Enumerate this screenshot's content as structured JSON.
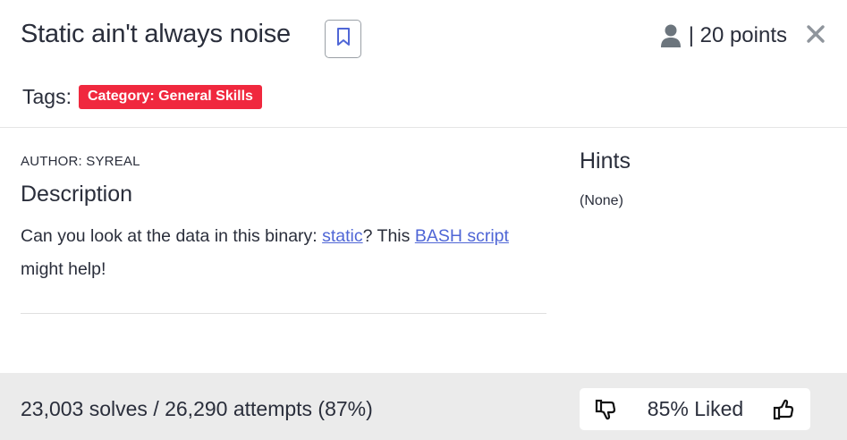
{
  "challenge": {
    "title": "Static ain't always noise",
    "points_label": "| 20 points"
  },
  "tags": {
    "label": "Tags:",
    "badges": [
      "Category: General Skills"
    ],
    "badge_color": "#f0283e"
  },
  "details": {
    "author": "AUTHOR: SYREAL",
    "description_heading": "Description",
    "description_part1": "Can you look at the data in this binary: ",
    "link_static": "static",
    "description_part2": "? This ",
    "link_bash": "BASH script",
    "description_part3": " might help!"
  },
  "hints": {
    "heading": "Hints",
    "content": "(None)"
  },
  "stats": {
    "solves_text": "23,003 solves / 26,290 attempts (87%)",
    "liked_text": "85% Liked"
  },
  "icons": {
    "bookmark": "bookmark-icon",
    "user": "user-icon",
    "close": "close-icon",
    "thumbs_down": "thumbs-down-icon",
    "thumbs_up": "thumbs-up-icon"
  },
  "colors": {
    "link": "#4f66d6",
    "footer_bg": "#ebebeb"
  }
}
